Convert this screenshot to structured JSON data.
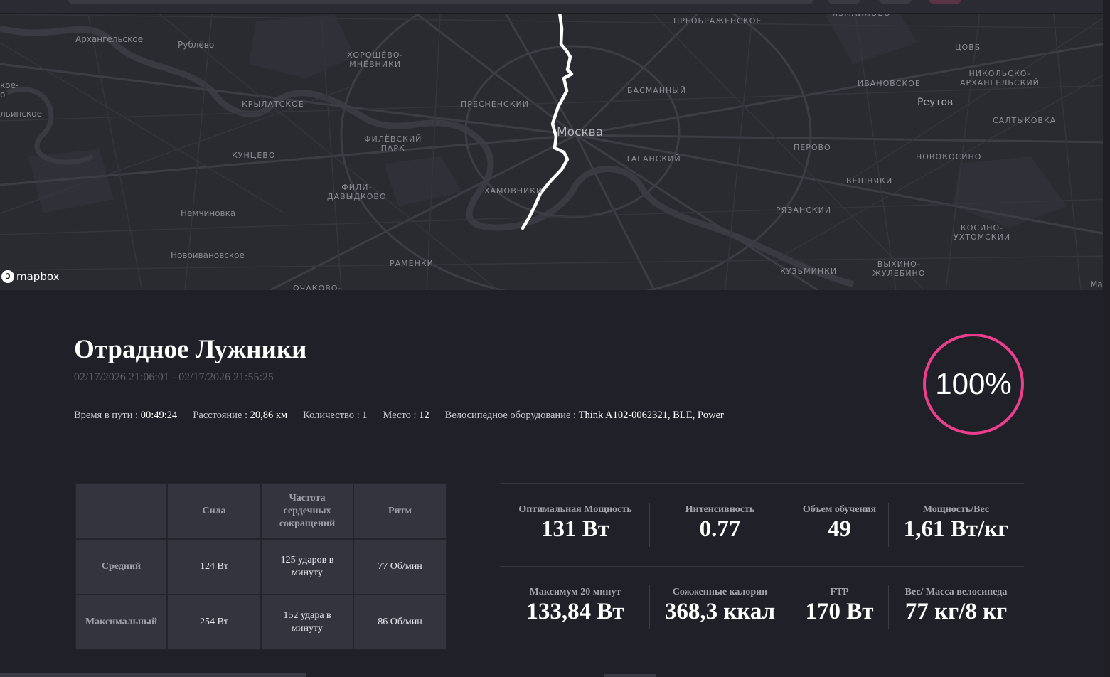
{
  "map": {
    "labels": [
      {
        "id": "arkh",
        "text": "Архангельское",
        "kind": "plain"
      },
      {
        "id": "rublevo",
        "text": "Рублёво",
        "kind": "plain"
      },
      {
        "id": "khorosh",
        "text": "ХОРОШЁВО-\nМНЁВНИКИ",
        "kind": "district"
      },
      {
        "id": "preobr",
        "text": "ПРЕОБРАЖЕНСКОЕ",
        "kind": "district"
      },
      {
        "id": "izmailovo",
        "text": "ИЗМАЙЛОВО",
        "kind": "district"
      },
      {
        "id": "tsvb",
        "text": "ЦОВБ",
        "kind": "district"
      },
      {
        "id": "koe",
        "text": "кое-\nо",
        "kind": "plain"
      },
      {
        "id": "ilinskoe",
        "text": "льинское",
        "kind": "plain"
      },
      {
        "id": "krylat",
        "text": "КРЫЛАТСКОЕ",
        "kind": "district"
      },
      {
        "id": "presn",
        "text": "ПРЕСНЕНСКИЙ",
        "kind": "district"
      },
      {
        "id": "basman",
        "text": "БАСМАННЫЙ",
        "kind": "district"
      },
      {
        "id": "ivanov",
        "text": "ИВАНОВСКОЕ",
        "kind": "district"
      },
      {
        "id": "nikol",
        "text": "НИКОЛЬСКО-\nАРХАНГЕЛЬСКИЙ",
        "kind": "district"
      },
      {
        "id": "reutov",
        "text": "Реутов",
        "kind": "town"
      },
      {
        "id": "moskva",
        "text": "Москва",
        "kind": "city"
      },
      {
        "id": "filev",
        "text": "ФИЛЁВСКИЙ\nПАРК",
        "kind": "district"
      },
      {
        "id": "saltyk",
        "text": "САЛТЫКОВКА",
        "kind": "district"
      },
      {
        "id": "kuntsevo",
        "text": "КУНЦЕВО",
        "kind": "district"
      },
      {
        "id": "perovo",
        "text": "ПЕРОВО",
        "kind": "district"
      },
      {
        "id": "taganski",
        "text": "ТАГАНСКИЙ",
        "kind": "district"
      },
      {
        "id": "novokos",
        "text": "НОВОКОСИНО",
        "kind": "district"
      },
      {
        "id": "fili",
        "text": "ФИЛИ-\nДАВЫДКОВО",
        "kind": "district"
      },
      {
        "id": "veshnyaki",
        "text": "ВЕШНЯКИ",
        "kind": "district"
      },
      {
        "id": "khamov",
        "text": "ХАМОВНИКИ",
        "kind": "district"
      },
      {
        "id": "nemch",
        "text": "Немчиновка",
        "kind": "plain"
      },
      {
        "id": "ryazan",
        "text": "РЯЗАНСКИЙ",
        "kind": "district"
      },
      {
        "id": "kosino",
        "text": "КОСИНО-\nУХТОМСКИЙ",
        "kind": "district"
      },
      {
        "id": "novoivan",
        "text": "Новоивановское",
        "kind": "plain"
      },
      {
        "id": "vykhino",
        "text": "ВЫХИНО-\nЖУЛЕБИНО",
        "kind": "district"
      },
      {
        "id": "ramenki",
        "text": "РАМЕНКИ",
        "kind": "district"
      },
      {
        "id": "kuzm",
        "text": "КУЗЬМИНКИ",
        "kind": "district"
      },
      {
        "id": "ochakovo",
        "text": "ОЧАКОВО-",
        "kind": "district"
      },
      {
        "id": "ma",
        "text": "Ма",
        "kind": "plain"
      }
    ],
    "attribution": "mapbox"
  },
  "ride": {
    "title": "Отрадное Лужники",
    "dates": "02/17/2026 21:06:01 - 02/17/2026 21:55:25",
    "meta": [
      {
        "label": "Время в пути : ",
        "value": "00:49:24"
      },
      {
        "label": "Расстояние : ",
        "value": "20,86 км"
      },
      {
        "label": "Количество : ",
        "value": "1"
      },
      {
        "label": "Место : ",
        "value": "12"
      },
      {
        "label": "Велосипедное оборудование : ",
        "value": "Think A102-0062321, BLE, Power"
      }
    ],
    "completion": "100%",
    "completion_fraction": 1.0,
    "accent_color": "#ec3e8d"
  },
  "table": {
    "headers": [
      "",
      "Сила",
      "Частота сердечных сокращений",
      "Ритм"
    ],
    "rows": [
      [
        "Средний",
        "124 Вт",
        "125 ударов в минуту",
        "77 Об/мин"
      ],
      [
        "Максимальный",
        "254 Вт",
        "152 удара в минуту",
        "86 Об/мин"
      ]
    ]
  },
  "stats": {
    "top": [
      {
        "label": "Оптимальная Мощность",
        "value": "131 Вт"
      },
      {
        "label": "Интенсивность",
        "value": "0.77"
      },
      {
        "label": "Объем обучения",
        "value": "49"
      },
      {
        "label": "Мощность/Вес",
        "value": "1,61 Вт/кг"
      }
    ],
    "bottom": [
      {
        "label": "Максимум 20 минут",
        "value": "133,84 Вт"
      },
      {
        "label": "Сожженные калории",
        "value": "368,3 ккал"
      },
      {
        "label": "FTP",
        "value": "170 Вт"
      },
      {
        "label": "Вес/ Масса велосипеда",
        "value": "77 кг/8 кг"
      }
    ]
  }
}
